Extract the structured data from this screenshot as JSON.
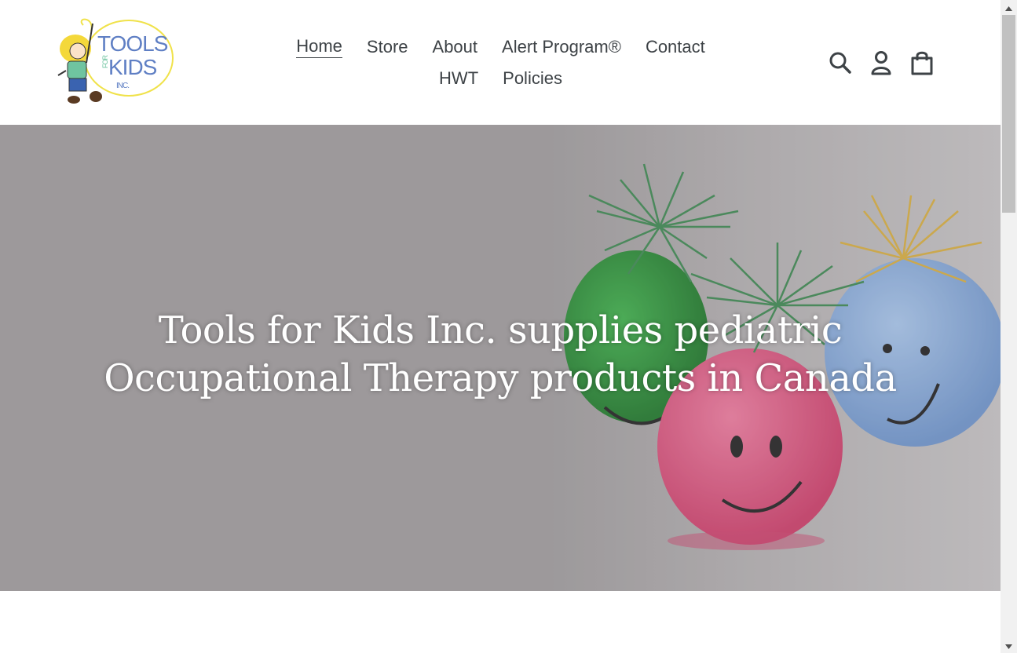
{
  "brand": {
    "logo_line1": "TOOLS",
    "logo_for": "FOR",
    "logo_line2": "KIDS",
    "logo_inc": "INC."
  },
  "nav": {
    "items_row1": [
      {
        "label": "Home",
        "active": true
      },
      {
        "label": "Store",
        "active": false
      },
      {
        "label": "About",
        "active": false
      },
      {
        "label": "Alert Program®",
        "active": false
      },
      {
        "label": "Contact",
        "active": false
      }
    ],
    "items_row2": [
      {
        "label": "HWT",
        "active": false
      },
      {
        "label": "Policies",
        "active": false
      }
    ]
  },
  "header_icons": [
    "search-icon",
    "account-icon",
    "cart-icon"
  ],
  "hero": {
    "title_line1": "Tools for Kids Inc. supplies pediatric",
    "title_line2": "Occupational Therapy products in Canada",
    "overlay_color": "#a19e9f"
  },
  "colors": {
    "text": "#3d4246",
    "logo_blue": "#5f7fc4",
    "logo_yellow": "#f0e24a",
    "ball_green": "#2e9a3a",
    "ball_pink": "#e4507a",
    "ball_blue": "#8fb4e0"
  }
}
